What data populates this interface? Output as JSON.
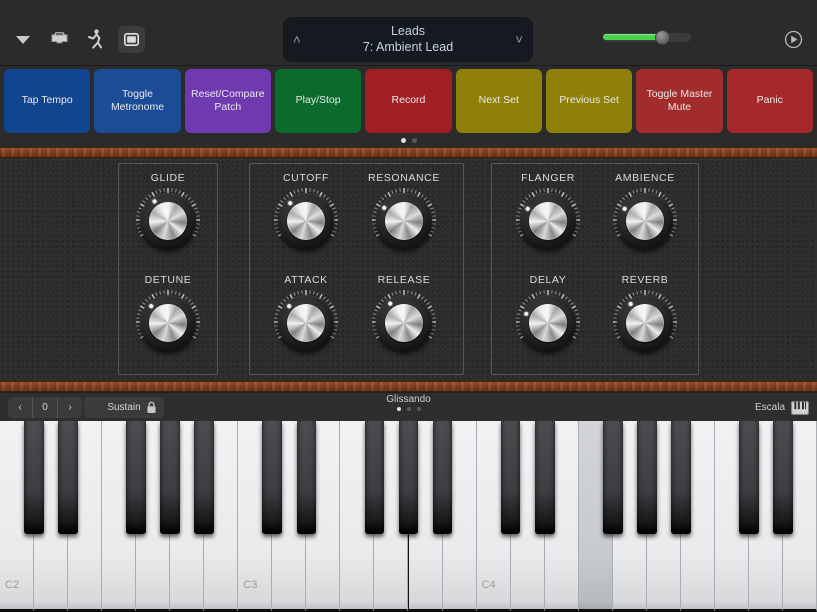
{
  "topbar": {
    "icons": [
      {
        "name": "chevron-down-icon",
        "glyph": "triangle-down"
      },
      {
        "name": "inbox-icon",
        "glyph": "inbox"
      },
      {
        "name": "walking-person-icon",
        "glyph": "person"
      },
      {
        "name": "window-icon",
        "glyph": "window"
      }
    ],
    "patch": {
      "category": "Leads",
      "name": "7: Ambient Lead",
      "prev_chevron": "˄",
      "next_chevron": "˅"
    },
    "volume": {
      "value_percent": 66,
      "fill_color": "#4cd252"
    },
    "power_icon": "play-circle-icon"
  },
  "controls": {
    "buttons": [
      {
        "label": "Tap Tempo",
        "color": "#12458f"
      },
      {
        "label": "Toggle Metronome",
        "color": "#1b4c95"
      },
      {
        "label": "Reset/Compare Patch",
        "color": "#6f3ab0"
      },
      {
        "label": "Play/Stop",
        "color": "#0b6b2c"
      },
      {
        "label": "Record",
        "color": "#a11f24"
      },
      {
        "label": "Next Set",
        "color": "#8e8008"
      },
      {
        "label": "Previous Set",
        "color": "#8e8008"
      },
      {
        "label": "Toggle Master Mute",
        "color": "#a22b2b"
      },
      {
        "label": "Panic",
        "color": "#a5292c"
      }
    ],
    "page_dots": {
      "count": 2,
      "active": 0
    }
  },
  "knob_groups": [
    {
      "group": 1,
      "knobs": [
        {
          "label": "GLIDE",
          "angle": -123
        },
        {
          "label": "DETUNE",
          "angle": -135
        }
      ]
    },
    {
      "group": 2,
      "knobs": [
        {
          "label": "CUTOFF",
          "angle": -131
        },
        {
          "label": "RESONANCE",
          "angle": -148
        },
        {
          "label": "ATTACK",
          "angle": -135
        },
        {
          "label": "RELEASE",
          "angle": -124
        }
      ]
    },
    {
      "group": 3,
      "knobs": [
        {
          "label": "FLANGER",
          "angle": -151
        },
        {
          "label": "AMBIENCE",
          "angle": -151
        },
        {
          "label": "DELAY",
          "angle": -160
        },
        {
          "label": "REVERB",
          "angle": -126
        }
      ]
    }
  ],
  "keyboard_toolbar": {
    "octave_prev": "‹",
    "octave_value": "0",
    "octave_next": "›",
    "sustain_label": "Sustain",
    "lock_icon": "lock-icon",
    "glissando_label": "Glissando",
    "glissando_dots": {
      "count": 3,
      "active": 0
    },
    "escala_label": "Escala",
    "escala_icon": "piano-keys-icon"
  },
  "piano": {
    "octave_labels": [
      "C2",
      "C3",
      "C4"
    ],
    "pressed_key_index": 17,
    "white_key_count": 24
  }
}
